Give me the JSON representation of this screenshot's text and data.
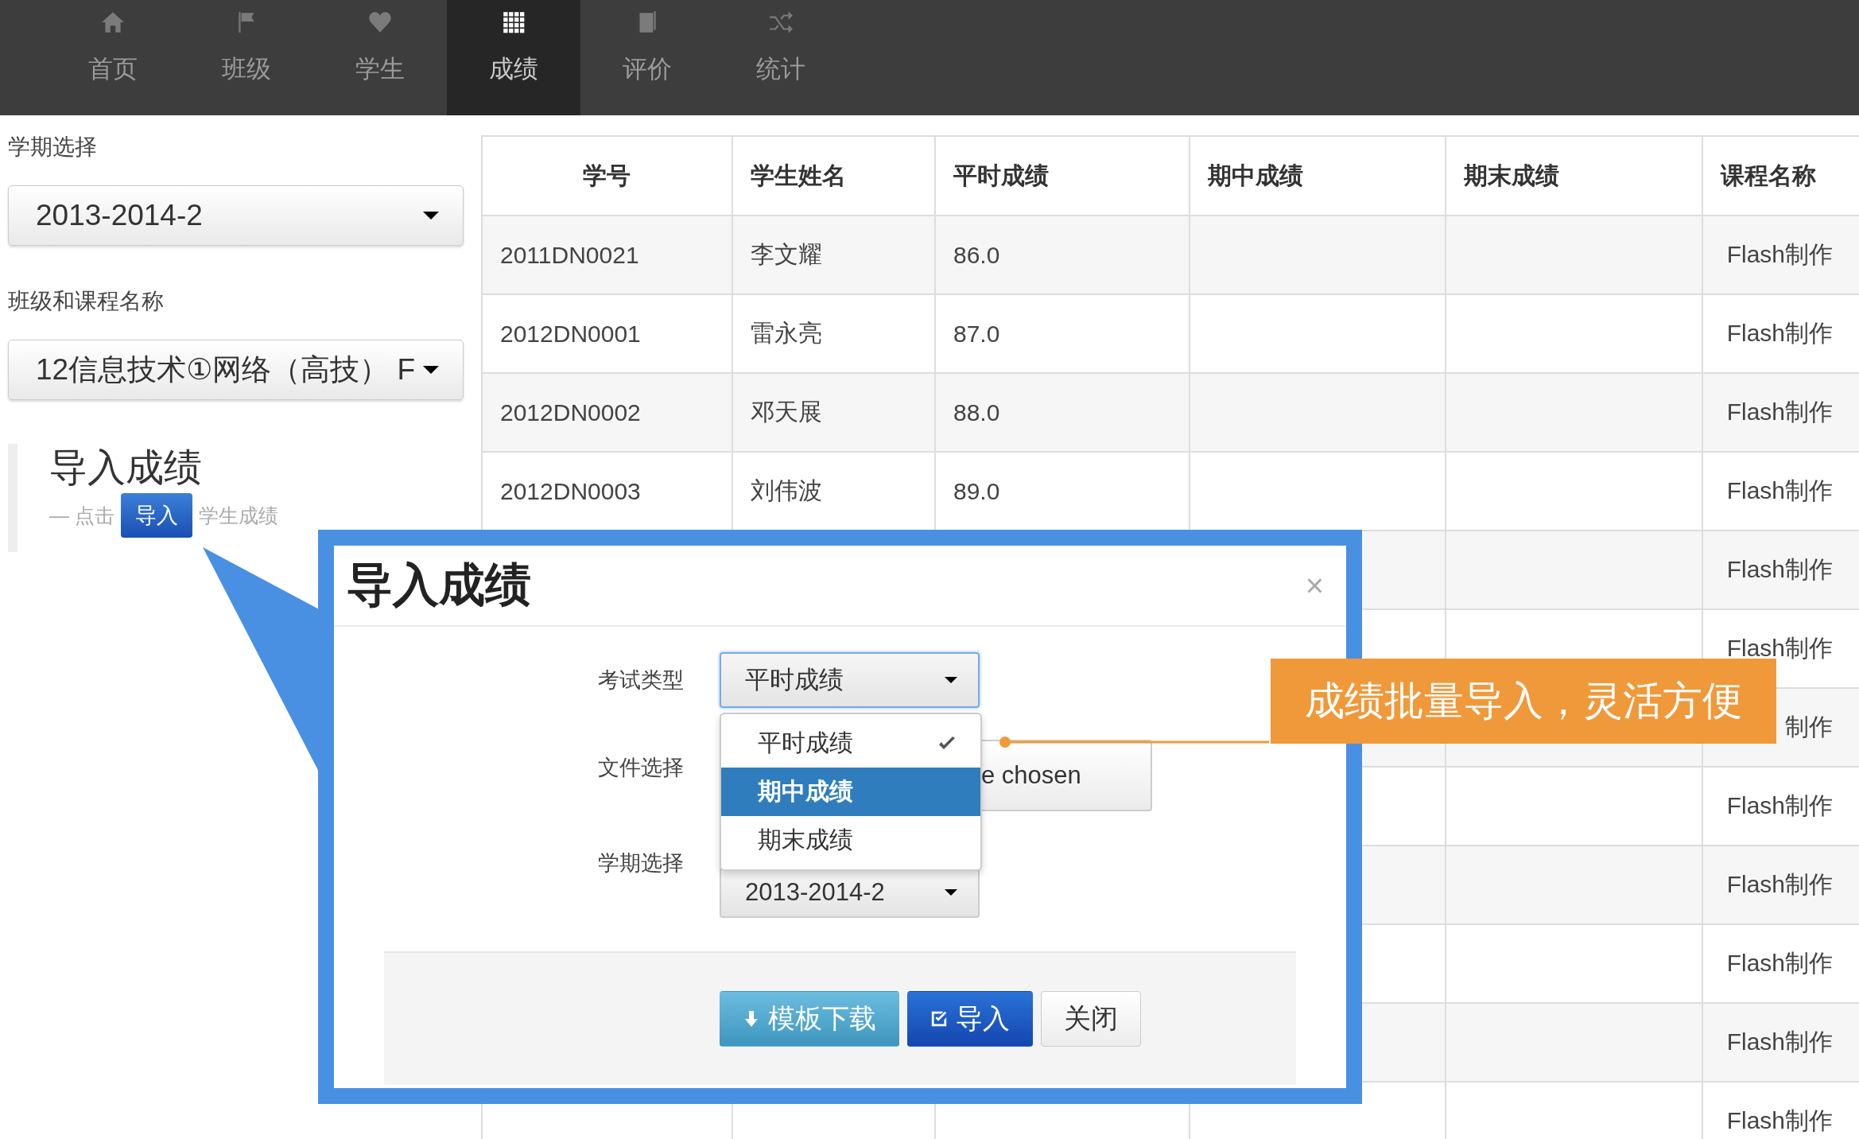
{
  "nav": {
    "items": [
      {
        "label": "首页",
        "selected": false
      },
      {
        "label": "班级",
        "selected": false
      },
      {
        "label": "学生",
        "selected": false
      },
      {
        "label": "成绩",
        "selected": true
      },
      {
        "label": "评价",
        "selected": false
      },
      {
        "label": "统计",
        "selected": false
      }
    ]
  },
  "sidebar": {
    "term_label": "学期选择",
    "term_value": "2013-2014-2",
    "class_label": "班级和课程名称",
    "class_value": "12信息技术①网络（高技） F",
    "import_title": "导入成绩",
    "import_hint_prefix": "— 点击",
    "import_button": "导入",
    "import_hint_suffix": "学生成绩"
  },
  "table": {
    "columns": [
      "学号",
      "学生姓名",
      "平时成绩",
      "期中成绩",
      "期末成绩",
      "课程名称"
    ],
    "rows": [
      {
        "student_id": "2011DN0021",
        "name": "李文耀",
        "regular_score": "86.0",
        "course": "Flash制作"
      },
      {
        "student_id": "2012DN0001",
        "name": "雷永亮",
        "regular_score": "87.0",
        "course": "Flash制作"
      },
      {
        "student_id": "2012DN0002",
        "name": "邓天展",
        "regular_score": "88.0",
        "course": "Flash制作"
      },
      {
        "student_id": "2012DN0003",
        "name": "刘伟波",
        "regular_score": "89.0",
        "course": "Flash制作"
      },
      {
        "course": "Flash制作"
      },
      {
        "course": "Flash制作"
      },
      {
        "course": "制作"
      },
      {
        "course": "Flash制作"
      },
      {
        "course": "Flash制作"
      },
      {
        "course": "Flash制作"
      },
      {
        "course": "Flash制作"
      },
      {
        "course": "Flash制作"
      }
    ]
  },
  "modal": {
    "title": "导入成绩",
    "close": "×",
    "fields": [
      {
        "label": "考试类型",
        "kind": "select",
        "value": "平时成绩",
        "focused": true
      },
      {
        "label": "文件选择",
        "kind": "file",
        "value": "e chosen"
      },
      {
        "label": "学期选择",
        "kind": "select",
        "value": "2013-2014-2",
        "focused": false
      }
    ],
    "dropdown": {
      "options": [
        {
          "label": "平时成绩",
          "checked": true,
          "selected": false
        },
        {
          "label": "期中成绩",
          "checked": false,
          "selected": true
        },
        {
          "label": "期末成绩",
          "checked": false,
          "selected": false
        }
      ]
    },
    "buttons": [
      {
        "label": "模板下载",
        "kind": "download"
      },
      {
        "label": "导入",
        "kind": "primary"
      },
      {
        "label": "关闭",
        "kind": "default"
      }
    ]
  },
  "callout": {
    "text": "成绩批量导入，灵活方便"
  }
}
